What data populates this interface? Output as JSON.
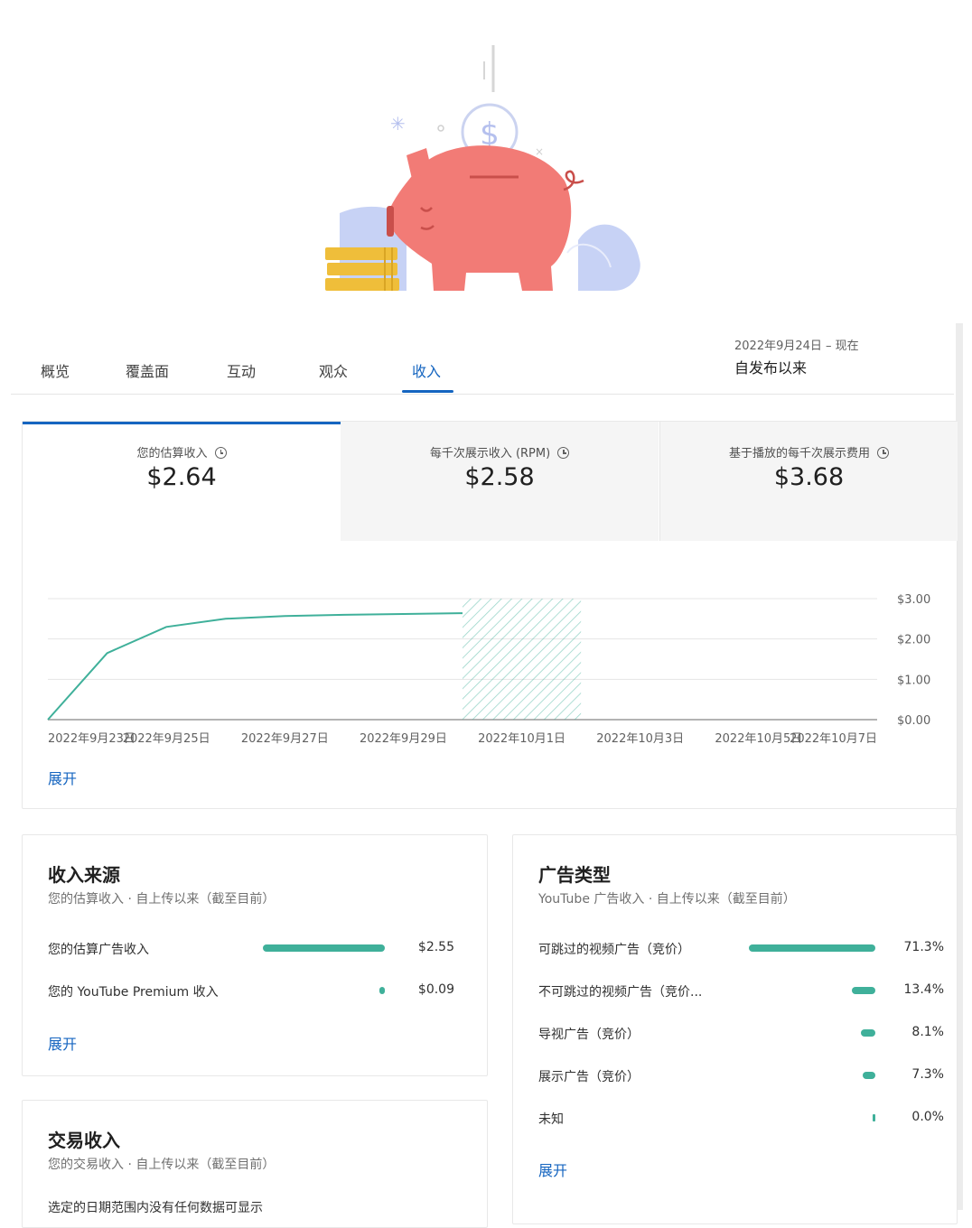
{
  "tabs": [
    {
      "label": "概览"
    },
    {
      "label": "覆盖面"
    },
    {
      "label": "互动"
    },
    {
      "label": "观众"
    },
    {
      "label": "收入",
      "active": true
    }
  ],
  "date_range": {
    "small": "2022年9月24日 – 现在",
    "main": "自发布以来"
  },
  "metrics": [
    {
      "label": "您的估算收入",
      "value": "$2.64"
    },
    {
      "label": "每千次展示收入 (RPM)",
      "value": "$2.58"
    },
    {
      "label": "基于播放的每千次展示费用",
      "value": "$3.68"
    }
  ],
  "chart_data": {
    "type": "line",
    "x": [
      "2022年9月23日",
      "2022年9月24日",
      "2022年9月25日",
      "2022年9月26日",
      "2022年9月27日",
      "2022年9月28日",
      "2022年9月29日",
      "2022年9月30日"
    ],
    "series": [
      {
        "values": [
          0.0,
          1.65,
          2.3,
          2.5,
          2.57,
          2.6,
          2.62,
          2.64
        ]
      }
    ],
    "x_tick_labels": [
      "2022年9月23日",
      "2022年9月25日",
      "2022年9月27日",
      "2022年9月29日",
      "2022年10月1日",
      "2022年10月3日",
      "2022年10月5日",
      "2022年10月7日"
    ],
    "y_tick_labels": [
      "$3.00",
      "$2.00",
      "$1.00",
      "$0.00"
    ],
    "ylim": [
      0,
      3
    ],
    "shaded_range": [
      "2022年9月30日",
      "2022年10月2日"
    ],
    "color": "#3fb09a",
    "grid": true
  },
  "chart_expand_label": "展开",
  "revenue_sources": {
    "title": "收入来源",
    "subtitle": "您的估算收入 · 自上传以来（截至目前）",
    "rows": [
      {
        "label": "您的估算广告收入",
        "value": "$2.55",
        "fraction": 0.966
      },
      {
        "label": "您的 YouTube Premium 收入",
        "value": "$0.09",
        "fraction": 0.034
      }
    ],
    "expand_label": "展开"
  },
  "ad_types": {
    "title": "广告类型",
    "subtitle": "YouTube 广告收入 · 自上传以来（截至目前）",
    "rows": [
      {
        "label": "可跳过的视频广告（竞价）",
        "value": "71.3%",
        "fraction": 0.713
      },
      {
        "label": "不可跳过的视频广告（竞价...",
        "value": "13.4%",
        "fraction": 0.134
      },
      {
        "label": "导视广告（竞价）",
        "value": "8.1%",
        "fraction": 0.081
      },
      {
        "label": "展示广告（竞价）",
        "value": "7.3%",
        "fraction": 0.073
      },
      {
        "label": "未知",
        "value": "0.0%",
        "fraction": 0.0
      }
    ],
    "expand_label": "展开"
  },
  "transaction": {
    "title": "交易收入",
    "subtitle": "您的交易收入 · 自上传以来（截至目前）",
    "empty_text": "选定的日期范围内没有任何数据可显示"
  },
  "colors": {
    "accent": "#1565c0",
    "bar": "#3fb09a",
    "pig": "#f27b76",
    "bush": "#c7d2f5",
    "coins": "#efbe3a"
  }
}
